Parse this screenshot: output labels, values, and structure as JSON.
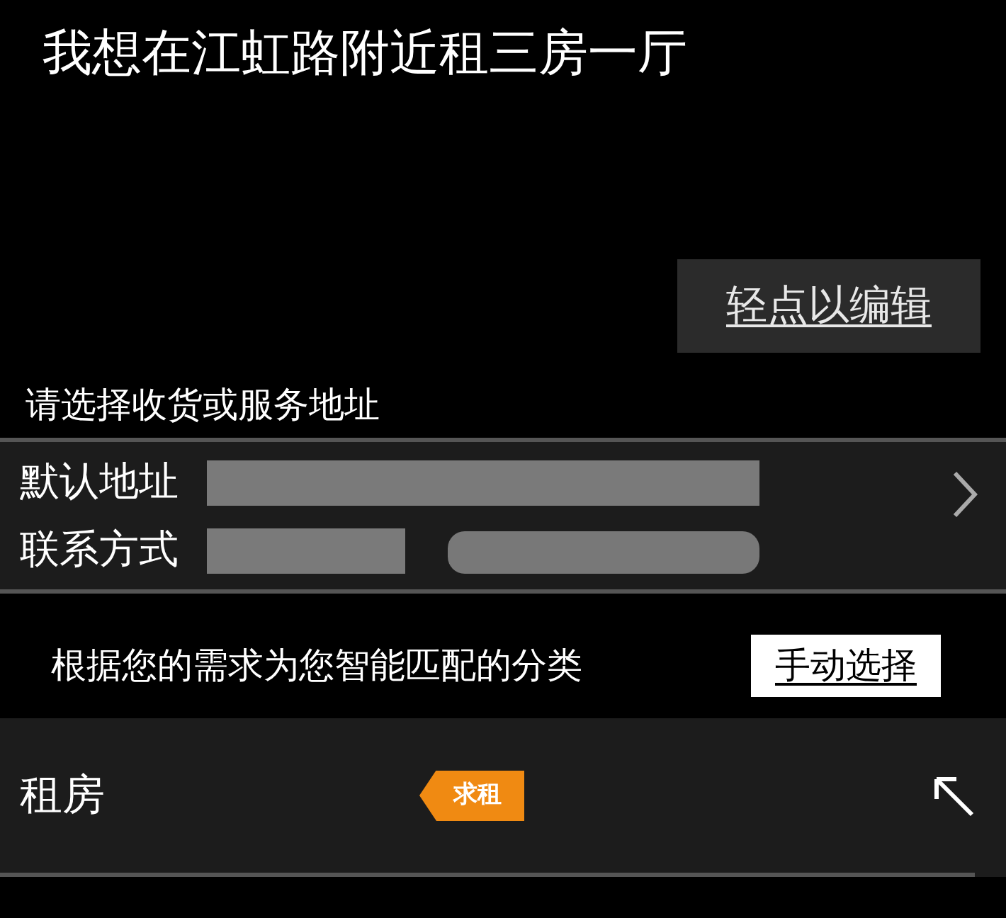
{
  "request_text": "我想在江虹路附近租三房一厅",
  "edit_button": "轻点以编辑",
  "address_prompt": "请选择收货或服务地址",
  "address_card": {
    "rows": [
      {
        "label": "默认地址"
      },
      {
        "label": "联系方式"
      }
    ]
  },
  "category_hint": "根据您的需求为您智能匹配的分类",
  "manual_select_button": "手动选择",
  "category": {
    "name": "租房",
    "tag": "求租"
  }
}
